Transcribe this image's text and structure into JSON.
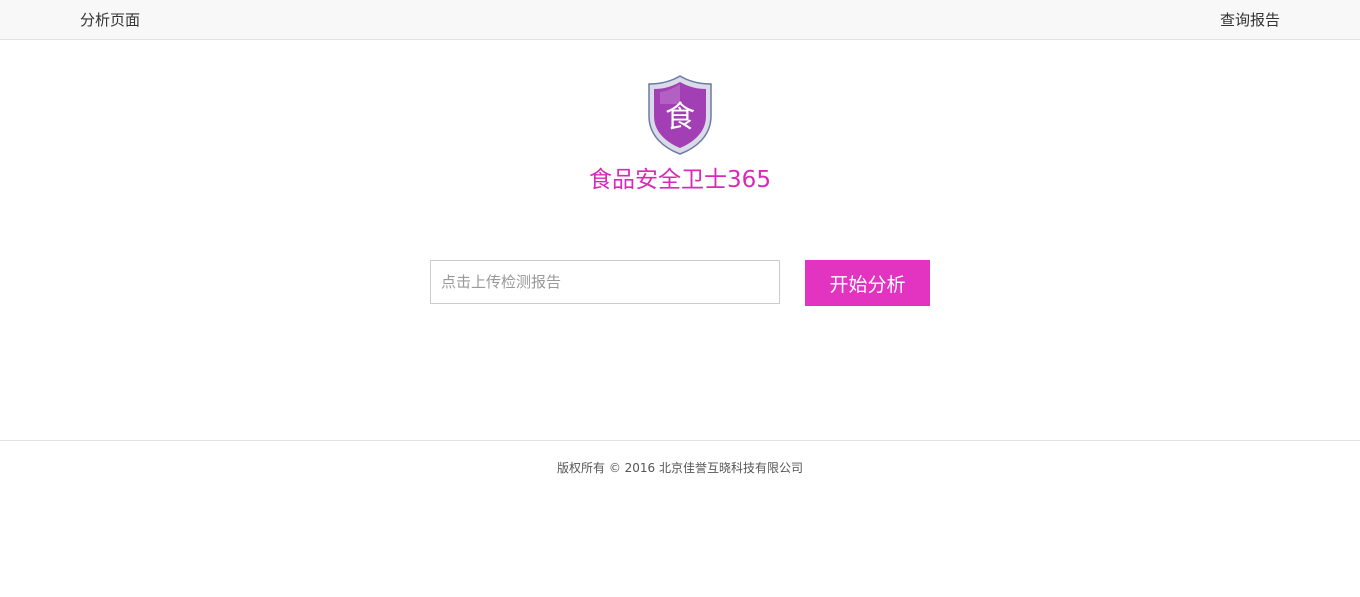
{
  "nav": {
    "left_label": "分析页面",
    "right_label": "查询报告"
  },
  "brand": {
    "title": "食品安全卫士365",
    "logo_glyph": "食",
    "logo_icon": "shield-icon",
    "accent_color": "#d929b8",
    "shield_color": "#a23fb5"
  },
  "upload": {
    "placeholder": "点击上传检测报告",
    "value": "",
    "button_label": "开始分析",
    "button_color": "#e333c1"
  },
  "footer": {
    "copyright": "版权所有 © 2016 北京佳誉互晓科技有限公司"
  }
}
